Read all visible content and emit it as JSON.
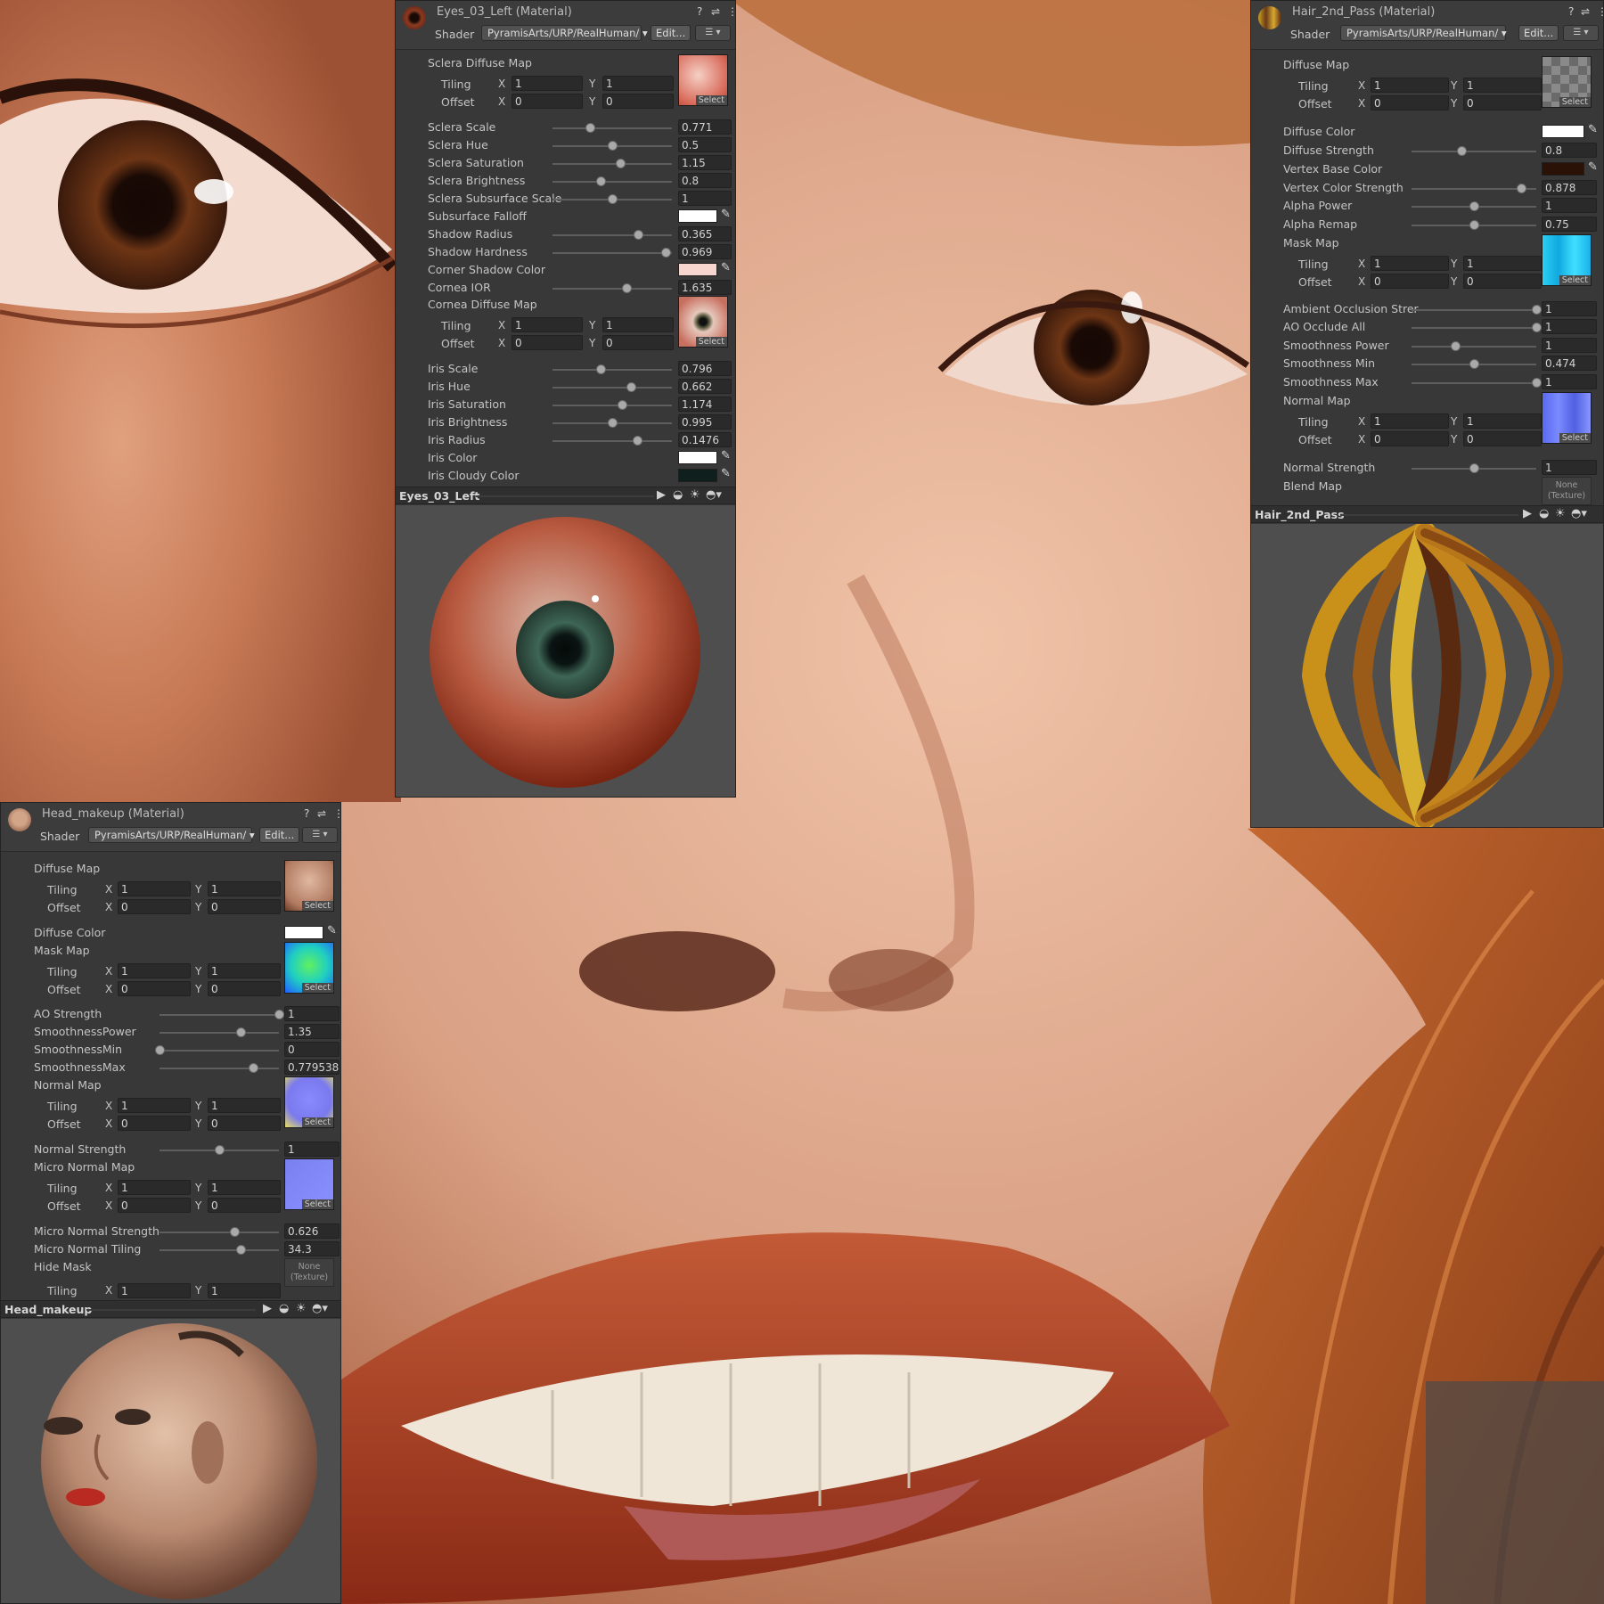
{
  "colors": {
    "panel_bg": "#383838",
    "field_bg": "#2a2a2a",
    "preview_bg": "#4e4e4e"
  },
  "ui_strings": {
    "shader_label": "Shader",
    "edit_button": "Edit...",
    "select_label": "Select",
    "tiling_label": "Tiling",
    "offset_label": "Offset",
    "x_axis": "X",
    "y_axis": "Y",
    "none_texture_line1": "None",
    "none_texture_line2": "(Texture)"
  },
  "eyes": {
    "title": "Eyes_03_Left (Material)",
    "shader": "PyramisArts/URP/RealHuman/",
    "footer_name": "Eyes_03_Left",
    "sclera_map": {
      "label": "Sclera Diffuse Map",
      "tiling_x": "1",
      "tiling_y": "1",
      "offset_x": "0",
      "offset_y": "0"
    },
    "sliders": [
      {
        "label": "Sclera Scale",
        "value": "0.771",
        "level": 0.31
      },
      {
        "label": "Sclera Hue",
        "value": "0.5",
        "level": 0.5
      },
      {
        "label": "Sclera Saturation",
        "value": "1.15",
        "level": 0.57
      },
      {
        "label": "Sclera Brightness",
        "value": "0.8",
        "level": 0.4
      },
      {
        "label": "Sclera Subsurface Scale",
        "value": "1",
        "level": 0.5
      }
    ],
    "subsurface_falloff": {
      "label": "Subsurface Falloff",
      "color": "#ffffff"
    },
    "sliders2": [
      {
        "label": "Shadow Radius",
        "value": "0.365",
        "level": 0.72
      },
      {
        "label": "Shadow Hardness",
        "value": "0.969",
        "level": 0.95
      }
    ],
    "corner_shadow_color": {
      "label": "Corner Shadow Color",
      "color": "#f7d6cf"
    },
    "cornea_ior": {
      "label": "Cornea IOR",
      "value": "1.635",
      "level": 0.62
    },
    "cornea_map": {
      "label": "Cornea Diffuse Map",
      "tiling_x": "1",
      "tiling_y": "1",
      "offset_x": "0",
      "offset_y": "0"
    },
    "sliders3": [
      {
        "label": "Iris Scale",
        "value": "0.796",
        "level": 0.4
      },
      {
        "label": "Iris Hue",
        "value": "0.662",
        "level": 0.66
      },
      {
        "label": "Iris Saturation",
        "value": "1.174",
        "level": 0.58
      },
      {
        "label": "Iris Brightness",
        "value": "0.995",
        "level": 0.5
      },
      {
        "label": "Iris Radius",
        "value": "0.1476",
        "level": 0.71
      }
    ],
    "iris_color": {
      "label": "Iris Color",
      "color": "#ffffff"
    },
    "iris_cloudy_color": {
      "label": "Iris Cloudy Color",
      "color": "#0f1f1d"
    }
  },
  "hair": {
    "title": "Hair_2nd_Pass (Material)",
    "shader": "PyramisArts/URP/RealHuman/",
    "footer_name": "Hair_2nd_Pass",
    "diffuse_map": {
      "label": "Diffuse Map",
      "tiling_x": "1",
      "tiling_y": "1",
      "offset_x": "0",
      "offset_y": "0"
    },
    "diffuse_color": {
      "label": "Diffuse Color",
      "color": "#ffffff"
    },
    "diffuse_strength": {
      "label": "Diffuse Strength",
      "value": "0.8",
      "level": 0.4
    },
    "vertex_base_color": {
      "label": "Vertex Base Color",
      "color": "#2b1206"
    },
    "sliders": [
      {
        "label": "Vertex Color Strength",
        "value": "0.878",
        "level": 0.88
      },
      {
        "label": "Alpha Power",
        "value": "1",
        "level": 0.5
      },
      {
        "label": "Alpha Remap",
        "value": "0.75",
        "level": 0.5
      }
    ],
    "mask_map": {
      "label": "Mask Map",
      "tiling_x": "1",
      "tiling_y": "1",
      "offset_x": "0",
      "offset_y": "0"
    },
    "sliders2": [
      {
        "label": "Ambient Occlusion Strer",
        "value": "1",
        "level": 1.0
      },
      {
        "label": "AO Occlude All",
        "value": "1",
        "level": 1.0
      },
      {
        "label": "Smoothness Power",
        "value": "1",
        "level": 0.35
      },
      {
        "label": "Smoothness Min",
        "value": "0.474",
        "level": 0.5
      },
      {
        "label": "Smoothness Max",
        "value": "1",
        "level": 1.0
      }
    ],
    "normal_map": {
      "label": "Normal Map",
      "tiling_x": "1",
      "tiling_y": "1",
      "offset_x": "0",
      "offset_y": "0"
    },
    "normal_strength": {
      "label": "Normal Strength",
      "value": "1",
      "level": 0.5
    },
    "blend_map": {
      "label": "Blend Map"
    }
  },
  "head": {
    "title": "Head_makeup (Material)",
    "shader": "PyramisArts/URP/RealHuman/",
    "footer_name": "Head_makeup",
    "diffuse_map": {
      "label": "Diffuse Map",
      "tiling_x": "1",
      "tiling_y": "1",
      "offset_x": "0",
      "offset_y": "0"
    },
    "diffuse_color": {
      "label": "Diffuse Color",
      "color": "#ffffff"
    },
    "mask_map": {
      "label": "Mask Map",
      "tiling_x": "1",
      "tiling_y": "1",
      "offset_x": "0",
      "offset_y": "0"
    },
    "sliders": [
      {
        "label": "AO Strength",
        "value": "1",
        "level": 1.0
      },
      {
        "label": "SmoothnessPower",
        "value": "1.35",
        "level": 0.68
      },
      {
        "label": "SmoothnessMin",
        "value": "0",
        "level": 0.0
      },
      {
        "label": "SmoothnessMax",
        "value": "0.7795384",
        "level": 0.78
      }
    ],
    "normal_map": {
      "label": "Normal Map",
      "tiling_x": "1",
      "tiling_y": "1",
      "offset_x": "0",
      "offset_y": "0"
    },
    "normal_strength": {
      "label": "Normal Strength",
      "value": "1",
      "level": 0.5
    },
    "micro_normal_map": {
      "label": "Micro Normal Map",
      "tiling_x": "1",
      "tiling_y": "1",
      "offset_x": "0",
      "offset_y": "0"
    },
    "sliders2": [
      {
        "label": "Micro Normal Strength",
        "value": "0.626",
        "level": 0.63
      },
      {
        "label": "Micro Normal Tiling",
        "value": "34.3",
        "level": 0.68
      }
    ],
    "hide_mask": {
      "label": "Hide Mask"
    },
    "cut_tiling": {
      "label": "Tiling",
      "x": "1",
      "y": "1"
    }
  }
}
